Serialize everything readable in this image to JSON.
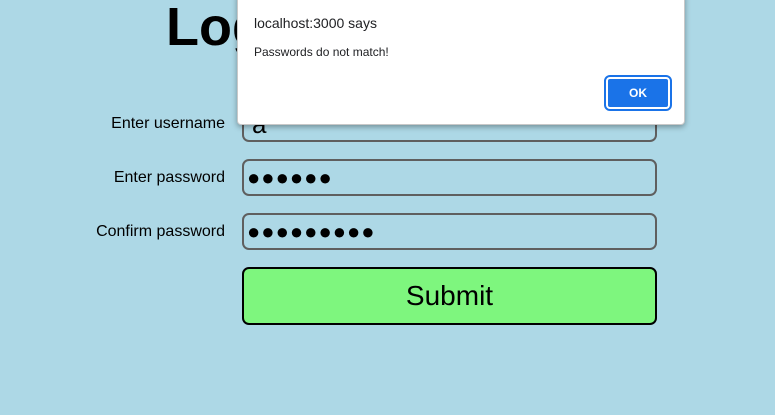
{
  "page": {
    "title": "Log",
    "background_color": "#add8e6"
  },
  "form": {
    "username": {
      "label": "Enter username",
      "value": "a"
    },
    "password": {
      "label": "Enter password",
      "value": "●●●●●●"
    },
    "confirm_password": {
      "label": "Confirm password",
      "value": "●●●●●●●●●"
    },
    "submit_label": "Submit",
    "submit_color": "#7ef67e"
  },
  "alert": {
    "origin": "localhost:3000 says",
    "message": "Passwords do not match!",
    "ok_label": "OK",
    "ok_color": "#1a73e8"
  }
}
